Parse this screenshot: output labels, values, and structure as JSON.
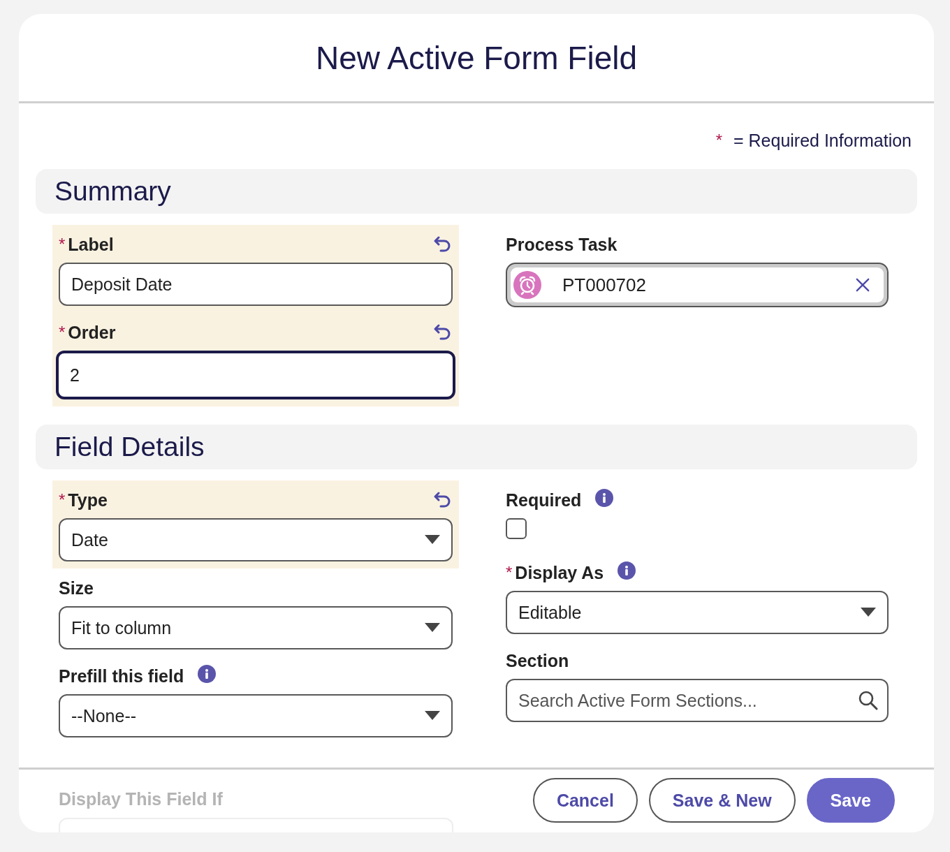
{
  "title": "New Active Form Field",
  "required_note": {
    "marker": "*",
    "text": "= Required Information"
  },
  "sections": [
    {
      "title": "Summary",
      "left": [
        {
          "kind": "text",
          "label": "Label",
          "required": true,
          "changed": true,
          "value": "Deposit Date",
          "focused": false
        },
        {
          "kind": "text",
          "label": "Order",
          "required": true,
          "changed": true,
          "value": "2",
          "focused": true
        }
      ],
      "right": [
        {
          "kind": "lookup",
          "label": "Process Task",
          "required": false,
          "changed": false,
          "value": "PT000702"
        }
      ]
    },
    {
      "title": "Field Details",
      "left": [
        {
          "kind": "select",
          "label": "Type",
          "required": true,
          "changed": true,
          "value": "Date"
        },
        {
          "kind": "select",
          "label": "Size",
          "required": false,
          "changed": false,
          "value": "Fit to column"
        },
        {
          "kind": "select",
          "label": "Prefill this field",
          "required": false,
          "changed": false,
          "info": true,
          "value": "--None--"
        }
      ],
      "right": [
        {
          "kind": "checkbox",
          "label": "Required",
          "required": false,
          "changed": false,
          "info": true,
          "checked": false
        },
        {
          "kind": "select",
          "label": "Display As",
          "required": true,
          "changed": false,
          "info": true,
          "value": "Editable"
        },
        {
          "kind": "search",
          "label": "Section",
          "required": false,
          "changed": false,
          "placeholder": "Search Active Form Sections..."
        }
      ]
    }
  ],
  "footer": {
    "hidden_field": {
      "label": "Display This Field If"
    },
    "buttons": [
      {
        "label": "Cancel",
        "kind": "neutral"
      },
      {
        "label": "Save & New",
        "kind": "neutral"
      },
      {
        "label": "Save",
        "kind": "brand"
      }
    ]
  }
}
